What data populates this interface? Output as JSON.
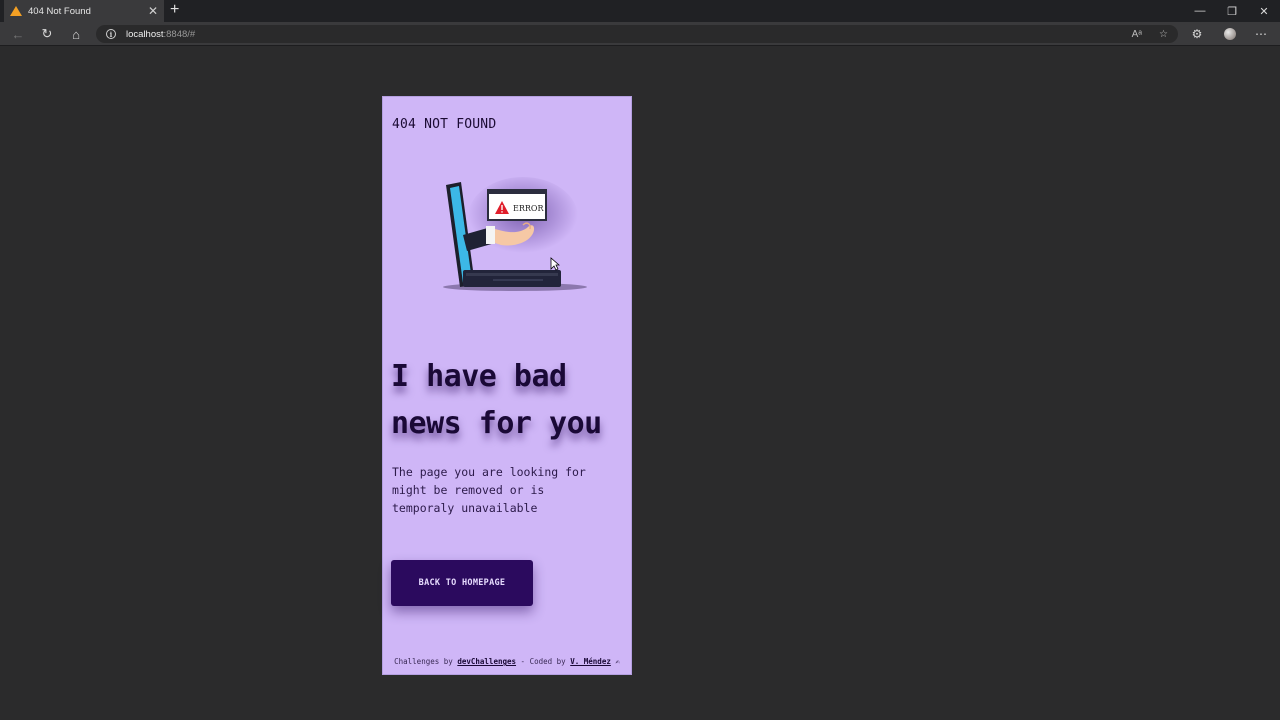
{
  "browser": {
    "tab_title": "404 Not Found",
    "new_tab_label": "+",
    "url_host": "localhost",
    "url_rest": ":8848/#",
    "window_controls": [
      "—",
      "❐",
      "✕"
    ]
  },
  "page": {
    "brand": "404 NOT FOUND",
    "illustration": {
      "popup_text": "ERROR"
    },
    "headline": "I have bad news for you",
    "subtext": "The page you are looking for might be removed or is temporaly unavailable",
    "button_label": "BACK TO HOMEPAGE",
    "footer": {
      "prefix": "Challenges by ",
      "challenges_link": "devChallenges",
      "middle": " - Coded by ",
      "author_link": "V. Méndez",
      "emoji": "✍"
    }
  },
  "colors": {
    "card_bg": "#cfb6f7",
    "button_bg": "#2b0a5e",
    "page_bg": "#2b2b2c"
  }
}
